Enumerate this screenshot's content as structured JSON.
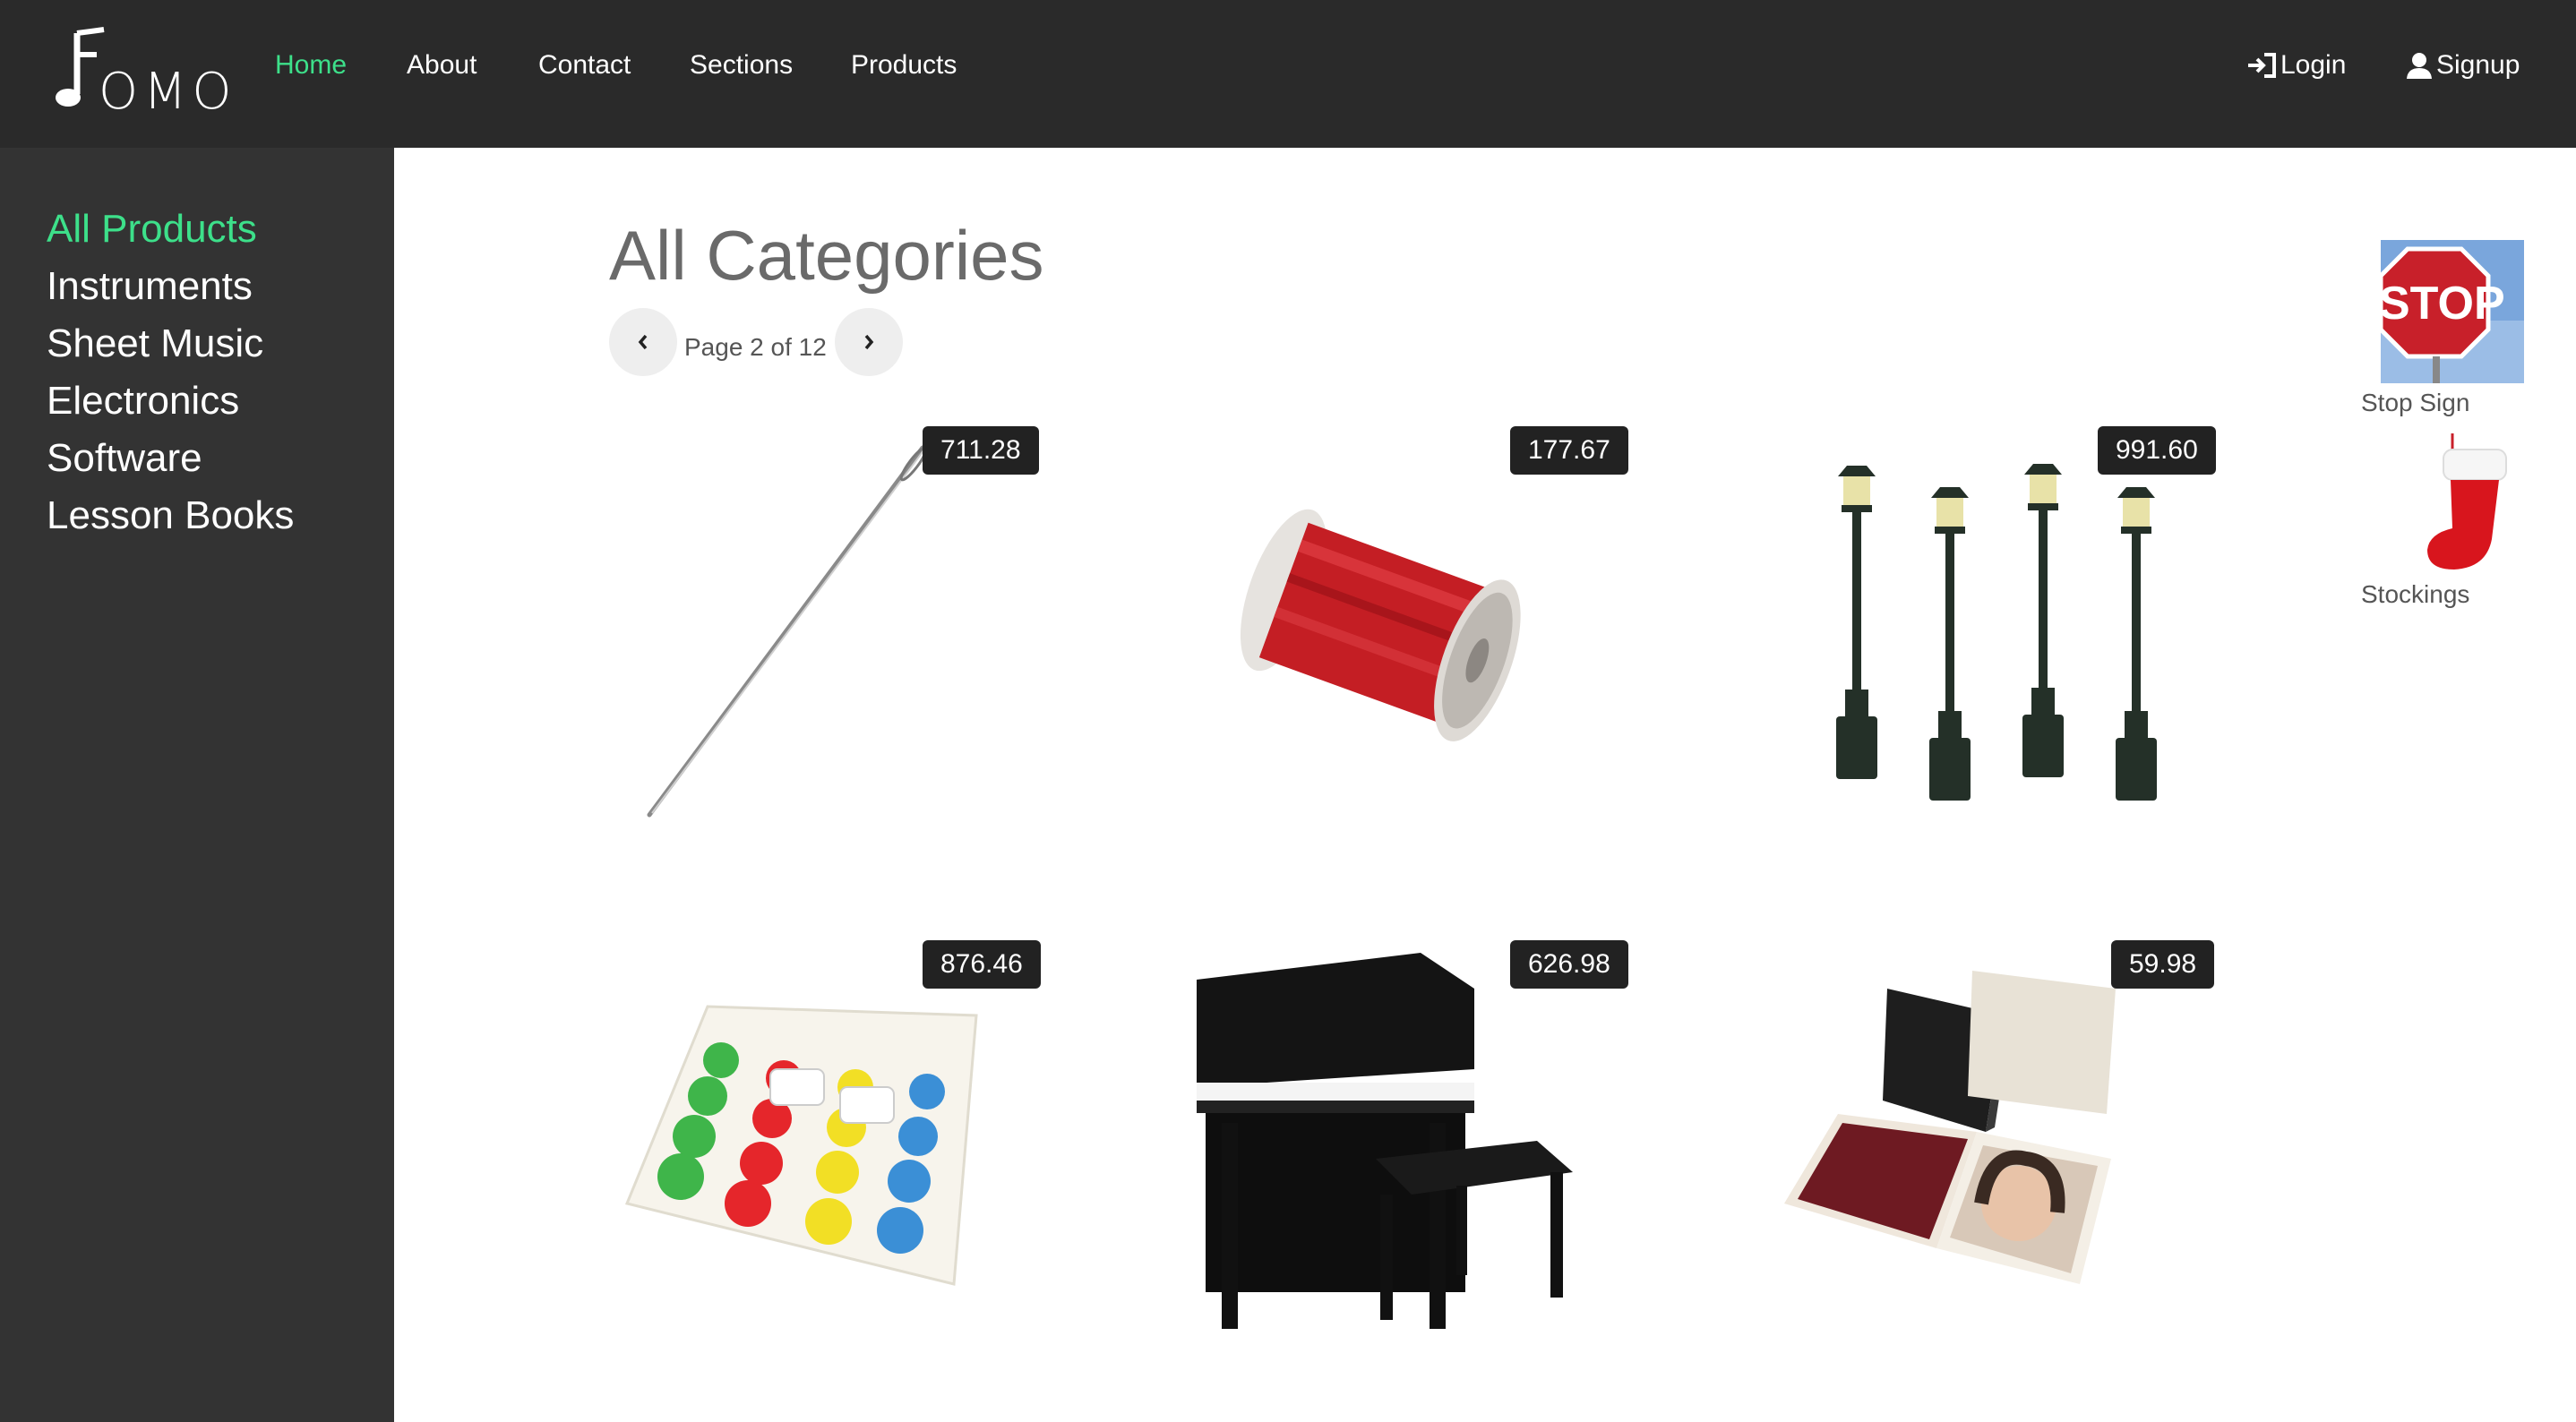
{
  "nav": {
    "logo_text": "OMO",
    "links": [
      {
        "label": "Home"
      },
      {
        "label": "About"
      },
      {
        "label": "Contact"
      },
      {
        "label": "Sections"
      },
      {
        "label": "Products"
      }
    ],
    "login_label": "Login",
    "signup_label": "Signup",
    "accent_color": "#3de08a"
  },
  "sidebar": {
    "items": [
      {
        "label": "All Products"
      },
      {
        "label": "Instruments"
      },
      {
        "label": "Sheet Music"
      },
      {
        "label": "Electronics"
      },
      {
        "label": "Software"
      },
      {
        "label": "Lesson Books"
      }
    ]
  },
  "main": {
    "title": "All Categories",
    "pager": {
      "text": "Page 2 of 12",
      "prev_icon": "chevron-left-icon",
      "next_icon": "chevron-right-icon"
    },
    "products": [
      {
        "price": "711.28",
        "image": "needle"
      },
      {
        "price": "177.67",
        "image": "thread-spool"
      },
      {
        "price": "991.60",
        "image": "lamp-posts"
      },
      {
        "price": "876.46",
        "image": "twister-mat"
      },
      {
        "price": "626.98",
        "image": "toy-piano"
      },
      {
        "price": "59.98",
        "image": "photo-album"
      }
    ]
  },
  "widgets": [
    {
      "label": "Stop Sign",
      "image": "stop-sign",
      "sign_text": "STOP"
    },
    {
      "label": "Stockings",
      "image": "stocking"
    }
  ]
}
